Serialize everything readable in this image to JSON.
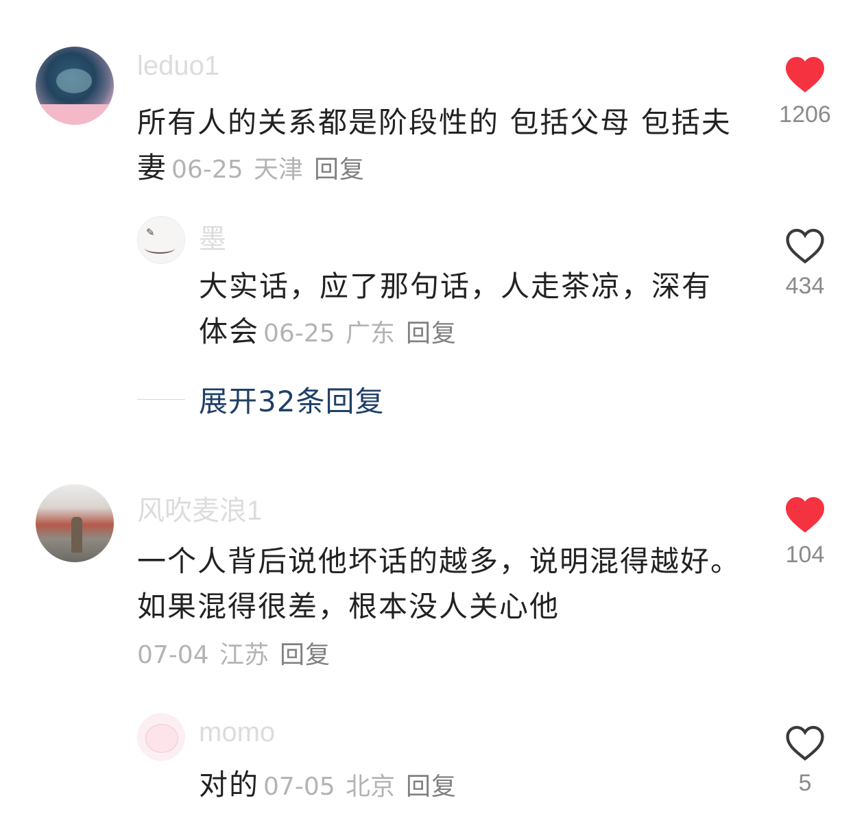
{
  "comments": [
    {
      "username": "leduo1",
      "avatar_icon": "avatar-galaxy-icon",
      "text": "所有人的关系都是阶段性的 包括父母 包括夫妻",
      "date": "06-25",
      "location": "天津",
      "reply_label": "回复",
      "likes": "1206",
      "liked": true,
      "replies": [
        {
          "username": "墨",
          "avatar_icon": "avatar-ink-cup-icon",
          "text": "大实话，应了那句话，人走茶凉，深有体会",
          "date": "06-25",
          "location": "广东",
          "reply_label": "回复",
          "likes": "434",
          "liked": false
        }
      ],
      "expand_label": "展开32条回复"
    },
    {
      "username": "风吹麦浪1",
      "avatar_icon": "avatar-photo-icon",
      "text": "一个人背后说他坏话的越多，说明混得越好。如果混得很差，根本没人关心他",
      "date": "07-04",
      "location": "江苏",
      "reply_label": "回复",
      "likes": "104",
      "liked": true,
      "replies": [
        {
          "username": "momo",
          "avatar_icon": "avatar-pig-icon",
          "text": "对的",
          "date": "07-05",
          "location": "北京",
          "reply_label": "回复",
          "likes": "5",
          "liked": false
        }
      ]
    }
  ],
  "colors": {
    "liked_heart": "#f5323f",
    "unliked_heart": "#3a3a3a",
    "expand_link": "#1f3f66",
    "meta_text": "#b3b3b3"
  }
}
